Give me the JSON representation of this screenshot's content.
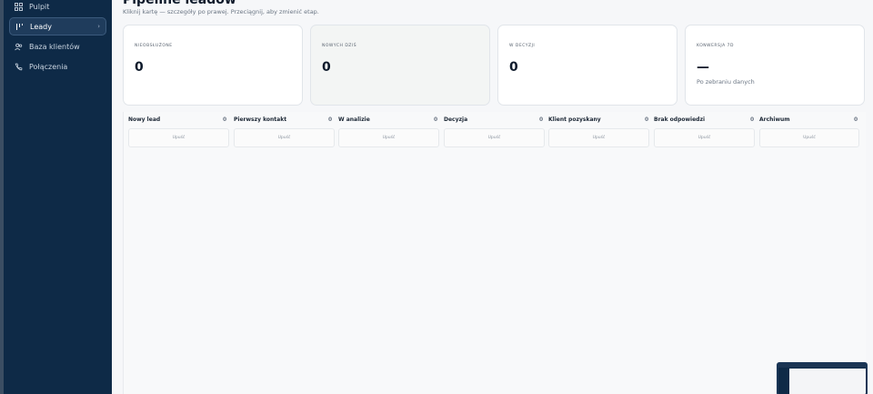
{
  "sidebar": {
    "items": [
      {
        "label": "Pulpit",
        "icon": "dashboard-icon"
      },
      {
        "label": "Leady",
        "icon": "pipeline-icon",
        "active": true
      },
      {
        "label": "Baza klientów",
        "icon": "users-icon"
      },
      {
        "label": "Połączenia",
        "icon": "phone-icon"
      }
    ]
  },
  "header": {
    "title": "Pipeline leadów",
    "subtitle": "Kliknij kartę — szczegóły po prawej. Przeciągnij, aby zmienić etap."
  },
  "stats": [
    {
      "label": "NIEOBSŁUŻONE",
      "value": "0"
    },
    {
      "label": "NOWYCH DZIŚ",
      "value": "0"
    },
    {
      "label": "W DECYZJI",
      "value": "0"
    },
    {
      "label": "KONWERSJA 7D",
      "value": "—",
      "note": "Po zebraniu danych"
    }
  ],
  "columns": [
    {
      "name": "Nowy lead",
      "count": "0",
      "drop": "Upuść"
    },
    {
      "name": "Pierwszy kontakt",
      "count": "0",
      "drop": "Upuść"
    },
    {
      "name": "W analizie",
      "count": "0",
      "drop": "Upuść"
    },
    {
      "name": "Decyzja",
      "count": "0",
      "drop": "Upuść"
    },
    {
      "name": "Klient pozyskany",
      "count": "0",
      "drop": "Upuść"
    },
    {
      "name": "Brak odpowiedzi",
      "count": "0",
      "drop": "Upuść"
    },
    {
      "name": "Archiwum",
      "count": "0",
      "drop": "Upuść"
    }
  ],
  "colors": {
    "sidebar": "#0e2a47",
    "background": "#f6f7f9",
    "text": "#0e1a2b"
  }
}
